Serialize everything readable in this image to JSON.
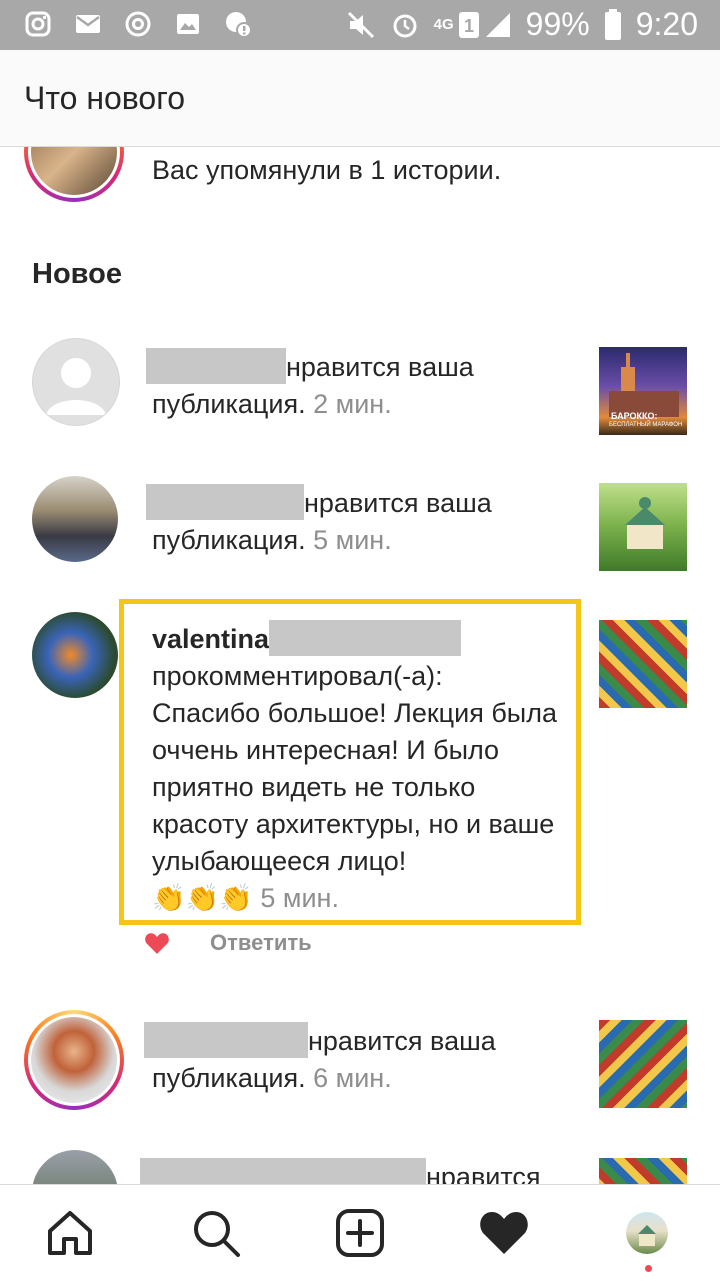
{
  "status_bar": {
    "battery": "99%",
    "time": "9:20",
    "network": "4G"
  },
  "header": {
    "title": "Что нового"
  },
  "story_mention": {
    "text": "Вас упомянули в 1 истории."
  },
  "section": {
    "title": "Новое"
  },
  "notifications": [
    {
      "action": "нравится ваша",
      "action2": "публикация.",
      "time": "2 мин.",
      "thumb_caption_1": "БАРОККО:",
      "thumb_caption_2": "БЕСПЛАТНЫЙ МАРАФОН"
    },
    {
      "action": "нравится ваша",
      "action2": "публикация.",
      "time": "5 мин."
    },
    {
      "username": "valentina",
      "action": "прокомментировал(-а):",
      "comment": "Спасибо большое! Лекция была оччень интересная! И было приятно видеть не только красоту архитектуры, но и ваше улыбающееся лицо!",
      "emoji": "👏👏👏",
      "time": "5 мин.",
      "reply_label": "Ответить"
    },
    {
      "action": "нравится ваша",
      "action2": "публикация.",
      "time": "6 мин."
    },
    {
      "action": "нравится"
    }
  ],
  "bottom_nav": {
    "items": [
      "home-icon",
      "search-icon",
      "add-post-icon",
      "activity-heart-icon",
      "profile-avatar"
    ]
  },
  "colors": {
    "status_bar_bg": "#a8a8a8",
    "highlight": "#f5c518",
    "like_red": "#ed4956",
    "muted_text": "#8e8e8e"
  }
}
